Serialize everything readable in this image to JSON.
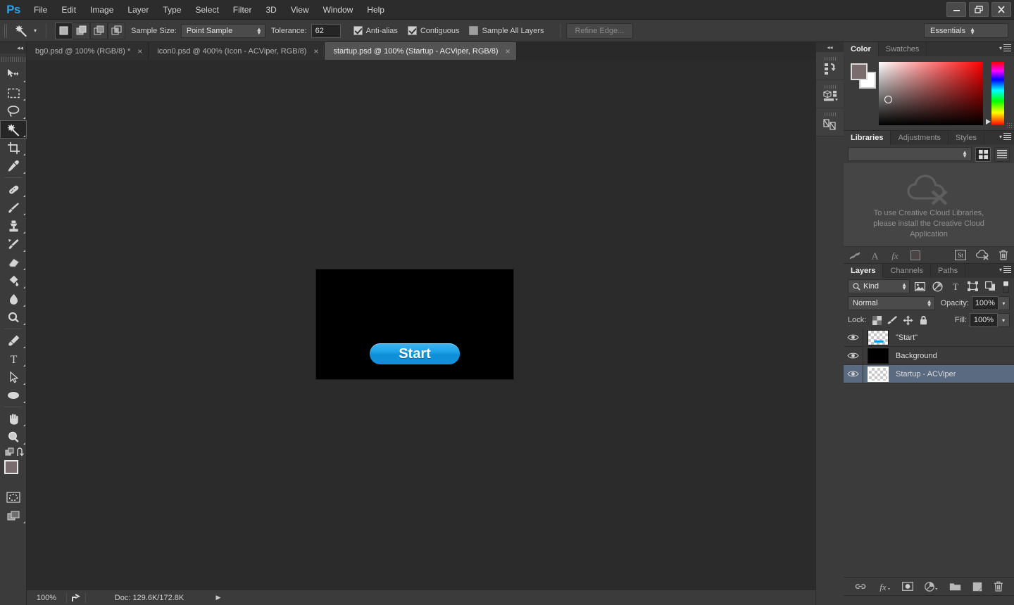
{
  "app": {
    "logo": "Ps",
    "menus": [
      "File",
      "Edit",
      "Image",
      "Layer",
      "Type",
      "Select",
      "Filter",
      "3D",
      "View",
      "Window",
      "Help"
    ],
    "window_controls": [
      "minimize",
      "restore",
      "close"
    ]
  },
  "options_bar": {
    "active_tool": "magic-wand",
    "selection_modes": [
      "new-selection",
      "add-to-selection",
      "subtract-from-selection",
      "intersect-with-selection"
    ],
    "active_selection_mode": 0,
    "sample_size_label": "Sample Size:",
    "sample_size_value": "Point Sample",
    "tolerance_label": "Tolerance:",
    "tolerance_value": "62",
    "anti_alias_label": "Anti-alias",
    "anti_alias_checked": true,
    "contiguous_label": "Contiguous",
    "contiguous_checked": true,
    "sample_all_layers_label": "Sample All Layers",
    "sample_all_layers_checked": false,
    "refine_edge_label": "Refine Edge...",
    "refine_edge_disabled": true,
    "workspace_value": "Essentials"
  },
  "toolbar": {
    "tools": [
      {
        "name": "move-tool",
        "active": false
      },
      {
        "name": "rectangular-marquee-tool",
        "active": false
      },
      {
        "name": "lasso-tool",
        "active": false
      },
      {
        "name": "magic-wand-tool",
        "active": true
      },
      {
        "name": "crop-tool",
        "active": false
      },
      {
        "name": "eyedropper-tool",
        "active": false
      },
      {
        "name": "spot-healing-brush-tool",
        "active": false
      },
      {
        "name": "brush-tool",
        "active": false
      },
      {
        "name": "clone-stamp-tool",
        "active": false
      },
      {
        "name": "history-brush-tool",
        "active": false
      },
      {
        "name": "eraser-tool",
        "active": false
      },
      {
        "name": "gradient-tool",
        "active": false
      },
      {
        "name": "blur-tool",
        "active": false
      },
      {
        "name": "dodge-tool",
        "active": false
      },
      {
        "name": "pen-tool",
        "active": false
      },
      {
        "name": "type-tool",
        "active": false
      },
      {
        "name": "path-selection-tool",
        "active": false
      },
      {
        "name": "ellipse-tool",
        "active": false
      },
      {
        "name": "hand-tool",
        "active": false
      },
      {
        "name": "zoom-tool",
        "active": false
      }
    ],
    "foreground_color": "#7a6c6c",
    "background_color": "#ffffff"
  },
  "document_tabs": [
    {
      "label": "bg0.psd @ 100% (RGB/8) *",
      "active": false
    },
    {
      "label": "icon0.psd @ 400% (Icon - ACViper, RGB/8)",
      "active": false
    },
    {
      "label": "startup.psd @ 100% (Startup - ACViper, RGB/8)",
      "active": true
    }
  ],
  "canvas": {
    "artboard_background": "#000000",
    "start_button_label": "Start",
    "start_button_color": "#1ba1e8"
  },
  "status_bar": {
    "zoom": "100%",
    "doc_info": "Doc: 129.6K/172.8K"
  },
  "icon_dock": [
    {
      "name": "history-panel-icon"
    },
    {
      "name": "3d-panel-icon"
    },
    {
      "name": "layer-comps-panel-icon"
    }
  ],
  "color_panel": {
    "tabs": [
      {
        "label": "Color",
        "active": true
      },
      {
        "label": "Swatches",
        "active": false
      }
    ],
    "foreground_color": "#7a6c6c",
    "background_color": "#ffffff"
  },
  "libraries_panel": {
    "tabs": [
      {
        "label": "Libraries",
        "active": true
      },
      {
        "label": "Adjustments",
        "active": false
      },
      {
        "label": "Styles",
        "active": false
      }
    ],
    "dropdown_value": "",
    "view_modes": [
      "grid-view",
      "list-view"
    ],
    "active_view_mode": 0,
    "empty_message_line1": "To use Creative Cloud Libraries,",
    "empty_message_line2": "please install the Creative Cloud",
    "empty_message_line3": "Application",
    "footer_icons": [
      "add-graphic-icon",
      "add-text-style-icon",
      "add-layer-style-icon",
      "add-color-icon",
      "stock-icon",
      "sync-icon",
      "delete-icon"
    ]
  },
  "layers_panel": {
    "tabs": [
      {
        "label": "Layers",
        "active": true
      },
      {
        "label": "Channels",
        "active": false
      },
      {
        "label": "Paths",
        "active": false
      }
    ],
    "filter_kind_label": "Kind",
    "filter_icons": [
      "pixel-filter-icon",
      "adjustment-filter-icon",
      "type-filter-icon",
      "shape-filter-icon",
      "smart-object-filter-icon"
    ],
    "blend_mode": "Normal",
    "opacity_label": "Opacity:",
    "opacity_value": "100%",
    "lock_label": "Lock:",
    "lock_icons": [
      "lock-transparent-pixels-icon",
      "lock-image-pixels-icon",
      "lock-position-icon",
      "lock-all-icon"
    ],
    "fill_label": "Fill:",
    "fill_value": "100%",
    "layers": [
      {
        "name": "\"Start\"",
        "visible": true,
        "selected": false,
        "thumb": "transparent-with-button"
      },
      {
        "name": "Background",
        "visible": true,
        "selected": false,
        "thumb": "black"
      },
      {
        "name": "Startup - ACViper",
        "visible": true,
        "selected": true,
        "thumb": "transparent"
      }
    ],
    "footer_icons": [
      "link-layers-icon",
      "add-layer-style-icon",
      "add-layer-mask-icon",
      "new-adjustment-layer-icon",
      "new-group-icon",
      "new-layer-icon",
      "delete-layer-icon"
    ]
  }
}
